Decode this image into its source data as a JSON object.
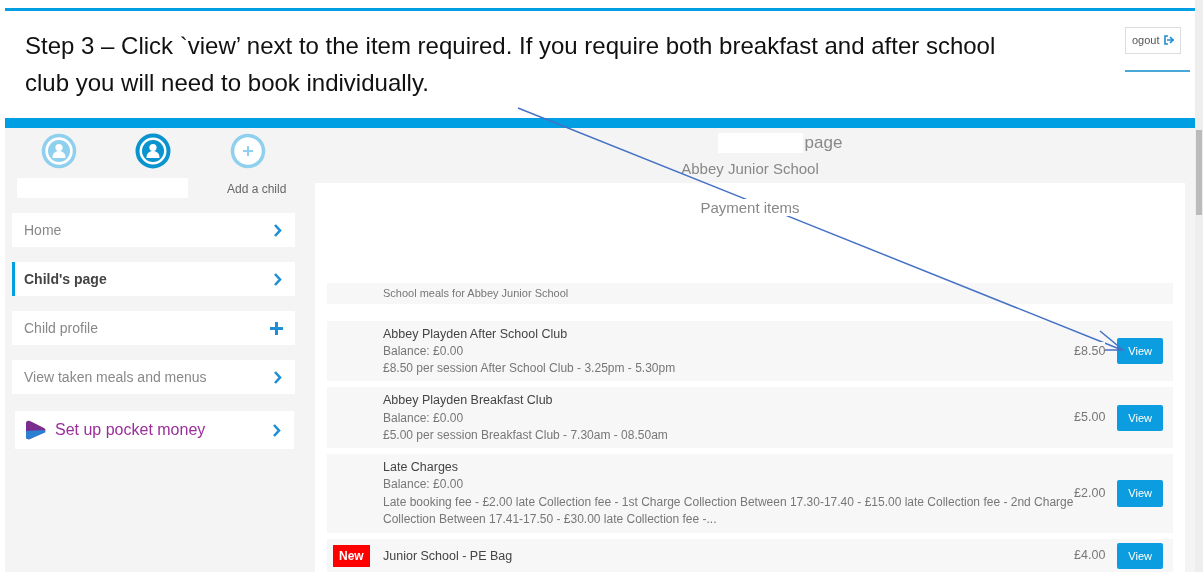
{
  "instruction": {
    "text": "Step 3 – Click `view’ next to the item required. If you require both breakfast and after school club you will need to book individually."
  },
  "header": {
    "logout_label": "ogout"
  },
  "children": [
    {
      "kind": "child",
      "selected": false
    },
    {
      "kind": "child",
      "selected": true
    },
    {
      "kind": "add",
      "label": "Add a child"
    }
  ],
  "sidebar": {
    "items": [
      {
        "label": "Home",
        "kind": "link",
        "selected": false
      },
      {
        "label": "Child's page",
        "kind": "link",
        "selected": true
      },
      {
        "label": "Child profile",
        "kind": "expand",
        "selected": false
      },
      {
        "label": "View taken meals and menus",
        "kind": "link",
        "selected": false
      },
      {
        "label": "Set up pocket money",
        "kind": "promo",
        "selected": false
      }
    ]
  },
  "page": {
    "title_suffix": "page",
    "school": "Abbey Junior School",
    "section_title": "Payment items"
  },
  "items": [
    {
      "kind": "partial",
      "description": "School meals for Abbey Junior School"
    },
    {
      "kind": "item",
      "new": false,
      "name": "Abbey Playden After School Club",
      "balance": "Balance: £0.00",
      "description": "£8.50 per session After School Club - 3.25pm - 5.30pm",
      "price": "£8.50",
      "button": "View"
    },
    {
      "kind": "item",
      "new": false,
      "name": "Abbey Playden Breakfast Club",
      "balance": "Balance: £0.00",
      "description": "£5.00 per session Breakfast Club - 7.30am - 08.50am",
      "price": "£5.00",
      "button": "View"
    },
    {
      "kind": "item",
      "new": false,
      "name": "Late Charges",
      "balance": "Balance: £0.00",
      "description": "Late booking fee - £2.00 late Collection fee - 1st Charge Collection Between 17.30-17.40 - £15.00 late Collection fee - 2nd Charge Collection Between 17.41-17.50 - £30.00 late Collection fee -...",
      "price": "£2.00",
      "button": "View"
    },
    {
      "kind": "item",
      "new": true,
      "new_label": "New",
      "name": "Junior School - PE Bag",
      "price": "£4.00",
      "button": "View"
    }
  ]
}
